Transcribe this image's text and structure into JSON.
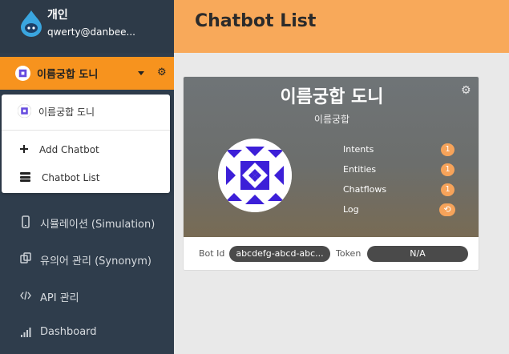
{
  "profile": {
    "name": "개인",
    "email": "qwerty@danbee..."
  },
  "bot_selector": {
    "current_bot": "이름궁합 도니"
  },
  "dropdown": {
    "bot_item": "이름궁합 도니",
    "add_chatbot": "Add Chatbot",
    "chatbot_list": "Chatbot List"
  },
  "nav": [
    {
      "label": "시뮬레이션 (Simulation)",
      "icon": "phone-icon"
    },
    {
      "label": "유의어 관리 (Synonym)",
      "icon": "copy-icon"
    },
    {
      "label": "API 관리",
      "icon": "code-icon"
    },
    {
      "label": "Dashboard",
      "icon": "bar-chart-icon"
    }
  ],
  "header": {
    "title": "Chatbot List"
  },
  "card": {
    "name": "이름궁합 도니",
    "subtitle": "이름궁합",
    "stats": [
      {
        "label": "Intents",
        "value": "1"
      },
      {
        "label": "Entities",
        "value": "1"
      },
      {
        "label": "Chatflows",
        "value": "1"
      },
      {
        "label": "Log",
        "value": "⟲"
      }
    ],
    "bot_id_label": "Bot Id",
    "bot_id_value": "abcdefg-abcd-abc...",
    "token_label": "Token",
    "token_value": "N/A"
  },
  "colors": {
    "sidebar_bg": "#2f3d4c",
    "accent_orange": "#f7931e",
    "header_bg": "#f8a95a",
    "badge": "#f6a35a",
    "avatar_blue": "#3c1fd8"
  }
}
